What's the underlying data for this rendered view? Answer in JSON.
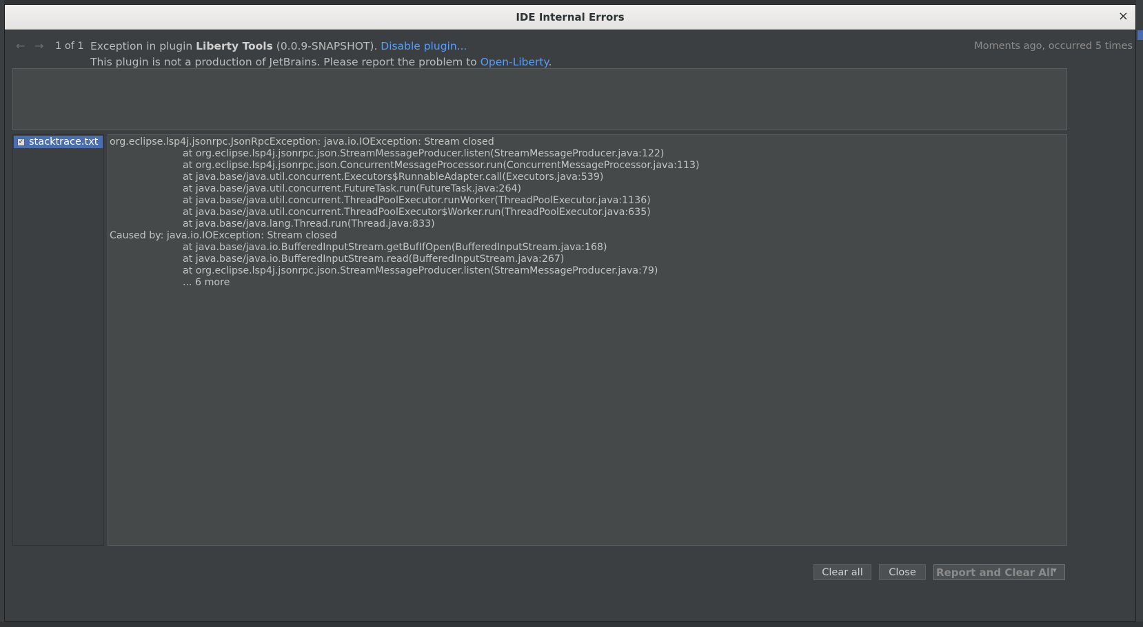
{
  "window": {
    "title": "IDE Internal Errors",
    "close_glyph": "×"
  },
  "header": {
    "prev_glyph": "←",
    "next_glyph": "→",
    "counter": "1 of 1",
    "exception_prefix": "Exception in plugin ",
    "plugin_name": "Liberty Tools",
    "plugin_version": " (0.0.9-SNAPSHOT). ",
    "disable_link": "Disable plugin...",
    "report_note": "This plugin is not a production of JetBrains. Please report the problem to ",
    "vendor_link": "Open-Liberty",
    "report_note_end": ".",
    "occurrence": "Moments ago, occurred 5 times"
  },
  "attachments": [
    {
      "label": "stacktrace.txt",
      "checked": true,
      "check_glyph": "✓"
    }
  ],
  "stacktrace": [
    "org.eclipse.lsp4j.jsonrpc.JsonRpcException: java.io.IOException: Stream closed",
    "at org.eclipse.lsp4j.jsonrpc.json.StreamMessageProducer.listen(StreamMessageProducer.java:122)",
    "at org.eclipse.lsp4j.jsonrpc.json.ConcurrentMessageProcessor.run(ConcurrentMessageProcessor.java:113)",
    "at java.base/java.util.concurrent.Executors$RunnableAdapter.call(Executors.java:539)",
    "at java.base/java.util.concurrent.FutureTask.run(FutureTask.java:264)",
    "at java.base/java.util.concurrent.ThreadPoolExecutor.runWorker(ThreadPoolExecutor.java:1136)",
    "at java.base/java.util.concurrent.ThreadPoolExecutor$Worker.run(ThreadPoolExecutor.java:635)",
    "at java.base/java.lang.Thread.run(Thread.java:833)",
    "Caused by: java.io.IOException: Stream closed",
    "at java.base/java.io.BufferedInputStream.getBufIfOpen(BufferedInputStream.java:168)",
    "at java.base/java.io.BufferedInputStream.read(BufferedInputStream.java:267)",
    "at org.eclipse.lsp4j.jsonrpc.json.StreamMessageProducer.listen(StreamMessageProducer.java:79)",
    "... 6 more"
  ],
  "footer": {
    "clear_all": "Clear all",
    "close": "Close",
    "report_and_clear": "Report and Clear All",
    "dropdown_glyph": "▾"
  },
  "colors": {
    "link": "#589df6",
    "selection": "#4b6eaf"
  }
}
